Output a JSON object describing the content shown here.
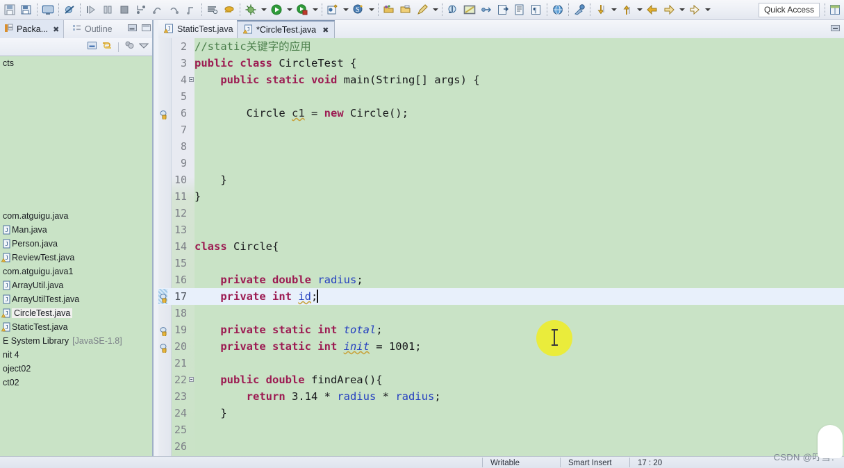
{
  "toolbar": {
    "quick_access": "Quick Access",
    "icons": [
      "save-icon",
      "save-all-icon",
      "sep",
      "console-icon",
      "sep",
      "skip-breakpoints-icon",
      "sep",
      "resume-icon",
      "suspend-icon",
      "terminate-icon",
      "step-into-icon",
      "step-over-icon",
      "step-return-icon",
      "drop-to-frame-icon",
      "sep",
      "coverage-icon",
      "profile-icon",
      "sep",
      "debug-icon",
      "debug-arrow",
      "run-icon",
      "run-arrow",
      "coverage-run-icon",
      "coverage-arrow",
      "sep",
      "new-java-project-icon",
      "new-arrow",
      "search-icon",
      "search-arrow",
      "sep",
      "open-type-icon",
      "open-resource-icon",
      "pencil-icon",
      "pencil-arrow",
      "sep",
      "previous-annotation-icon",
      "toggle-markoccurrences-icon",
      "link-icon",
      "open-task-icon",
      "toggle-block-selection-icon",
      "show-whitespace-icon",
      "sep",
      "open-web-browser-icon",
      "sep",
      "external-tools-icon",
      "sep",
      "next-edit-icon",
      "next-arrow",
      "previous-edit-icon",
      "previous-arrow",
      "back-icon",
      "forward-icon",
      "forward-arrow",
      "next-page-icon",
      "next-page-arrow"
    ]
  },
  "left_panel": {
    "tabs": [
      {
        "label": "Packa...",
        "icon": "package-explorer-icon",
        "active": true,
        "closable": true
      },
      {
        "label": "Outline",
        "icon": "outline-icon",
        "active": false,
        "closable": false
      }
    ],
    "window_buttons": [
      "minimize-icon",
      "maximize-icon"
    ],
    "view_toolbar": [
      "collapse-all-icon",
      "link-with-editor-icon",
      "separator",
      "view-menu-filters-icon",
      "view-menu-icon"
    ],
    "tree": [
      {
        "label": "cts",
        "icon": "none",
        "indent": 0,
        "clipped": true,
        "selected": false
      },
      {
        "label": "",
        "icon": "none",
        "indent": 0,
        "clipped": true,
        "selected": false
      },
      {
        "label": "",
        "icon": "none",
        "indent": 0,
        "clipped": true,
        "selected": false
      },
      {
        "label": "",
        "icon": "none",
        "indent": 0,
        "clipped": true,
        "selected": false
      },
      {
        "label": "",
        "icon": "none",
        "indent": 0,
        "clipped": true,
        "selected": false
      },
      {
        "label": "",
        "icon": "none",
        "indent": 0,
        "clipped": true,
        "selected": false
      },
      {
        "label": "",
        "icon": "none",
        "indent": 0,
        "clipped": true,
        "selected": false
      },
      {
        "label": "",
        "icon": "none",
        "indent": 0,
        "clipped": true,
        "selected": false
      },
      {
        "label": "",
        "icon": "none",
        "indent": 0,
        "clipped": true,
        "selected": false
      },
      {
        "label": "",
        "icon": "none",
        "indent": 0,
        "clipped": true,
        "selected": false
      },
      {
        "label": "",
        "icon": "none",
        "indent": 0,
        "clipped": true,
        "selected": false
      },
      {
        "label": "com.atguigu.java",
        "icon": "none",
        "indent": 0,
        "clipped": false,
        "selected": false
      },
      {
        "label": "Man.java",
        "icon": "java-file-icon",
        "indent": 0,
        "clipped": false,
        "selected": false
      },
      {
        "label": "Person.java",
        "icon": "java-file-icon",
        "indent": 0,
        "clipped": false,
        "selected": false
      },
      {
        "label": "ReviewTest.java",
        "icon": "java-file-warning-icon",
        "indent": 0,
        "clipped": false,
        "selected": false
      },
      {
        "label": "com.atguigu.java1",
        "icon": "none",
        "indent": 0,
        "clipped": false,
        "selected": false
      },
      {
        "label": "ArrayUtil.java",
        "icon": "java-file-icon",
        "indent": 0,
        "clipped": false,
        "selected": false
      },
      {
        "label": "ArrayUtilTest.java",
        "icon": "java-file-icon",
        "indent": 0,
        "clipped": false,
        "selected": false
      },
      {
        "label": "CircleTest.java",
        "icon": "java-file-warning-icon",
        "indent": 0,
        "clipped": false,
        "selected": true
      },
      {
        "label": "StaticTest.java",
        "icon": "java-file-warning-icon",
        "indent": 0,
        "clipped": false,
        "selected": false
      },
      {
        "label": "E System Library",
        "suffix": "[JavaSE-1.8]",
        "icon": "none",
        "indent": 0,
        "clipped": true,
        "selected": false
      },
      {
        "label": "nit 4",
        "icon": "none",
        "indent": 0,
        "clipped": true,
        "selected": false
      },
      {
        "label": "oject02",
        "icon": "none",
        "indent": 0,
        "clipped": true,
        "selected": false
      },
      {
        "label": "ct02",
        "icon": "none",
        "indent": 0,
        "clipped": true,
        "selected": false
      }
    ]
  },
  "editor": {
    "tabs": [
      {
        "label": "StaticTest.java",
        "icon": "java-file-warning-icon",
        "active": false,
        "dirty": false,
        "closable": false
      },
      {
        "label": "*CircleTest.java",
        "icon": "java-file-icon",
        "active": true,
        "dirty": true,
        "closable": true
      }
    ],
    "minimize_button": "minimize-icon",
    "lines": [
      {
        "n": "2",
        "fold": false,
        "mark": "none",
        "current": false,
        "tokens": [
          {
            "t": "//static关键字的应用",
            "c": "cm"
          }
        ]
      },
      {
        "n": "3",
        "fold": false,
        "mark": "none",
        "current": false,
        "tokens": [
          {
            "t": "public class ",
            "c": "kw"
          },
          {
            "t": "CircleTest {",
            "c": "pl"
          }
        ]
      },
      {
        "n": "4",
        "fold": true,
        "mark": "none",
        "current": false,
        "tokens": [
          {
            "t": "    ",
            "c": "pl"
          },
          {
            "t": "public static void ",
            "c": "kw"
          },
          {
            "t": "main(String[] args) {",
            "c": "pl"
          }
        ]
      },
      {
        "n": "5",
        "fold": false,
        "mark": "none",
        "current": false,
        "tokens": []
      },
      {
        "n": "6",
        "fold": false,
        "mark": "warning",
        "current": false,
        "tokens": [
          {
            "t": "        Circle ",
            "c": "pl"
          },
          {
            "t": "c1",
            "c": "loc sq"
          },
          {
            "t": " = ",
            "c": "pl"
          },
          {
            "t": "new ",
            "c": "kw"
          },
          {
            "t": "Circle();",
            "c": "pl"
          }
        ]
      },
      {
        "n": "7",
        "fold": false,
        "mark": "none",
        "current": false,
        "tokens": []
      },
      {
        "n": "8",
        "fold": false,
        "mark": "none",
        "current": false,
        "tokens": []
      },
      {
        "n": "9",
        "fold": false,
        "mark": "none",
        "current": false,
        "tokens": []
      },
      {
        "n": "10",
        "fold": false,
        "mark": "none",
        "current": false,
        "tokens": [
          {
            "t": "    }",
            "c": "pl"
          }
        ]
      },
      {
        "n": "11",
        "fold": false,
        "mark": "none",
        "current": false,
        "tokens": [
          {
            "t": "}",
            "c": "pl"
          }
        ]
      },
      {
        "n": "12",
        "fold": false,
        "mark": "none",
        "current": false,
        "tokens": []
      },
      {
        "n": "13",
        "fold": false,
        "mark": "none",
        "current": false,
        "tokens": []
      },
      {
        "n": "14",
        "fold": false,
        "mark": "none",
        "current": false,
        "tokens": [
          {
            "t": "class ",
            "c": "kw"
          },
          {
            "t": "Circle{",
            "c": "pl"
          }
        ]
      },
      {
        "n": "15",
        "fold": false,
        "mark": "none",
        "current": false,
        "tokens": []
      },
      {
        "n": "16",
        "fold": false,
        "mark": "none",
        "current": false,
        "tokens": [
          {
            "t": "    ",
            "c": "pl"
          },
          {
            "t": "private double ",
            "c": "kw"
          },
          {
            "t": "radius",
            "c": "fld"
          },
          {
            "t": ";",
            "c": "pl"
          }
        ]
      },
      {
        "n": "17",
        "fold": false,
        "mark": "warning",
        "current": true,
        "tokens": [
          {
            "t": "    ",
            "c": "pl"
          },
          {
            "t": "private int ",
            "c": "kw"
          },
          {
            "t": "id",
            "c": "fld sq"
          },
          {
            "t": ";",
            "c": "pl"
          }
        ],
        "caret_after": true
      },
      {
        "n": "18",
        "fold": false,
        "mark": "none",
        "current": false,
        "tokens": []
      },
      {
        "n": "19",
        "fold": false,
        "mark": "warning",
        "current": false,
        "tokens": [
          {
            "t": "    ",
            "c": "pl"
          },
          {
            "t": "private static int ",
            "c": "kw"
          },
          {
            "t": "total",
            "c": "fldst"
          },
          {
            "t": ";",
            "c": "pl"
          }
        ]
      },
      {
        "n": "20",
        "fold": false,
        "mark": "warning",
        "current": false,
        "tokens": [
          {
            "t": "    ",
            "c": "pl"
          },
          {
            "t": "private static int ",
            "c": "kw"
          },
          {
            "t": "init",
            "c": "fldst sq"
          },
          {
            "t": " = ",
            "c": "pl"
          },
          {
            "t": "1001",
            "c": "num0"
          },
          {
            "t": ";",
            "c": "pl"
          }
        ]
      },
      {
        "n": "21",
        "fold": false,
        "mark": "none",
        "current": false,
        "tokens": []
      },
      {
        "n": "22",
        "fold": true,
        "mark": "none",
        "current": false,
        "tokens": [
          {
            "t": "    ",
            "c": "pl"
          },
          {
            "t": "public double ",
            "c": "kw"
          },
          {
            "t": "findArea(){",
            "c": "pl"
          }
        ]
      },
      {
        "n": "23",
        "fold": false,
        "mark": "none",
        "current": false,
        "tokens": [
          {
            "t": "        ",
            "c": "pl"
          },
          {
            "t": "return ",
            "c": "kw"
          },
          {
            "t": "3.14",
            "c": "num0"
          },
          {
            "t": " * ",
            "c": "pl"
          },
          {
            "t": "radius",
            "c": "fld"
          },
          {
            "t": " * ",
            "c": "pl"
          },
          {
            "t": "radius",
            "c": "fld"
          },
          {
            "t": ";",
            "c": "pl"
          }
        ]
      },
      {
        "n": "24",
        "fold": false,
        "mark": "none",
        "current": false,
        "tokens": [
          {
            "t": "    }",
            "c": "pl"
          }
        ]
      },
      {
        "n": "25",
        "fold": false,
        "mark": "none",
        "current": false,
        "tokens": []
      },
      {
        "n": "26",
        "fold": false,
        "mark": "none",
        "current": false,
        "tokens": []
      }
    ]
  },
  "status_bar": {
    "writable": "Writable",
    "insert_mode": "Smart Insert",
    "position": "17 : 20"
  },
  "watermark": "CSDN @叮当！",
  "colors": {
    "editor_background": "#c9e3c6",
    "current_line": "#e8f0fb",
    "keyword": "#9c1b52",
    "comment": "#4b7f4b",
    "field": "#2540c0",
    "gutter": "#e8eaf1",
    "highlight_circle": "#f2ee18",
    "panel_chrome": "#e7ebf3"
  }
}
